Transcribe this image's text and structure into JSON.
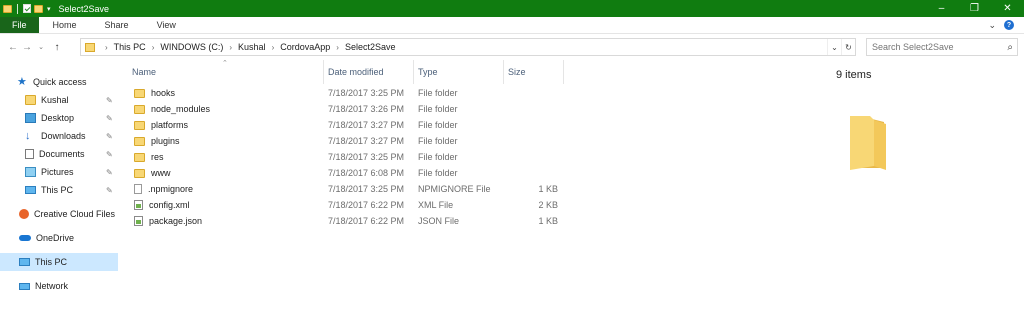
{
  "window": {
    "title": "Select2Save",
    "controls": [
      "–",
      "❐",
      "✕"
    ]
  },
  "ribbon": {
    "tabs": [
      "File",
      "Home",
      "Share",
      "View"
    ]
  },
  "address": {
    "breadcrumbs": [
      "This PC",
      "WINDOWS (C:)",
      "Kushal",
      "CordovaApp",
      "Select2Save"
    ]
  },
  "search": {
    "placeholder": "Search Select2Save"
  },
  "navigation": {
    "quick_access": "Quick access",
    "items": [
      {
        "label": "Kushal",
        "icon": "folder-icon",
        "pinned": true
      },
      {
        "label": "Desktop",
        "icon": "desktop-icon",
        "pinned": true
      },
      {
        "label": "Downloads",
        "icon": "download-icon",
        "pinned": true
      },
      {
        "label": "Documents",
        "icon": "documents-icon",
        "pinned": true
      },
      {
        "label": "Pictures",
        "icon": "pictures-icon",
        "pinned": true
      },
      {
        "label": "This PC",
        "icon": "computer-icon",
        "pinned": true
      }
    ],
    "creative_cloud": "Creative Cloud Files",
    "onedrive": "OneDrive",
    "this_pc": "This PC",
    "network": "Network"
  },
  "columns": {
    "name": "Name",
    "date": "Date modified",
    "type": "Type",
    "size": "Size"
  },
  "files": [
    {
      "name": "hooks",
      "date": "7/18/2017 3:25 PM",
      "type": "File folder",
      "size": "",
      "kind": "folder"
    },
    {
      "name": "node_modules",
      "date": "7/18/2017 3:26 PM",
      "type": "File folder",
      "size": "",
      "kind": "folder"
    },
    {
      "name": "platforms",
      "date": "7/18/2017 3:27 PM",
      "type": "File folder",
      "size": "",
      "kind": "folder"
    },
    {
      "name": "plugins",
      "date": "7/18/2017 3:27 PM",
      "type": "File folder",
      "size": "",
      "kind": "folder"
    },
    {
      "name": "res",
      "date": "7/18/2017 3:25 PM",
      "type": "File folder",
      "size": "",
      "kind": "folder"
    },
    {
      "name": "www",
      "date": "7/18/2017 6:08 PM",
      "type": "File folder",
      "size": "",
      "kind": "folder"
    },
    {
      "name": ".npmignore",
      "date": "7/18/2017 3:25 PM",
      "type": "NPMIGNORE File",
      "size": "1 KB",
      "kind": "file"
    },
    {
      "name": "config.xml",
      "date": "7/18/2017 6:22 PM",
      "type": "XML File",
      "size": "2 KB",
      "kind": "xml"
    },
    {
      "name": "package.json",
      "date": "7/18/2017 6:22 PM",
      "type": "JSON File",
      "size": "1 KB",
      "kind": "xml"
    }
  ],
  "preview": {
    "count": "9 items"
  },
  "colors": {
    "titlebar": "#107c10",
    "file_tab": "#19651a",
    "selection": "#cce8ff",
    "folder": "#f8d775"
  }
}
